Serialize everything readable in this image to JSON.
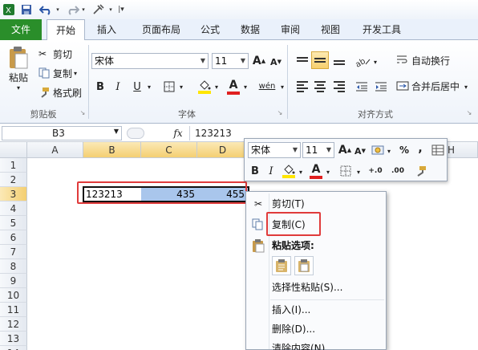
{
  "colors": {
    "file_tab": "#2a8e2a",
    "selected_header": "#f4cf72",
    "selection_fill": "#a9c6ec",
    "highlight_box": "#e03b3b",
    "font_color_bar": "#e02020",
    "fill_color_bar": "#ffe600"
  },
  "qat": {
    "icons": [
      "excel-logo-icon",
      "save-icon",
      "undo-icon",
      "redo-icon",
      "customize-icon"
    ]
  },
  "tabs": {
    "file": "文件",
    "items": [
      "开始",
      "插入",
      "页面布局",
      "公式",
      "数据",
      "审阅",
      "视图",
      "开发工具"
    ],
    "active": "开始"
  },
  "clipboard": {
    "group": "剪贴板",
    "paste": "粘贴",
    "cut": "剪切",
    "copy": "复制",
    "format_painter": "格式刷"
  },
  "font": {
    "group": "字体",
    "name": "宋体",
    "size": "11",
    "bold": "B",
    "italic": "I",
    "underline": "U",
    "grow": "A",
    "shrink": "A",
    "font_color": "A",
    "phonetic": "wén"
  },
  "alignment": {
    "group": "对齐方式",
    "wrap": "自动换行",
    "merge": "合并后居中"
  },
  "formula_bar": {
    "name_box": "B3",
    "fx": "fx",
    "value": "123213"
  },
  "columns": [
    "A",
    "B",
    "C",
    "D",
    "H"
  ],
  "rows": [
    "1",
    "2",
    "3",
    "4",
    "5",
    "6",
    "7",
    "8",
    "9",
    "10",
    "11",
    "12",
    "13",
    "14"
  ],
  "cells": {
    "B3": "123213",
    "C3": "435",
    "D3": "455"
  },
  "mini_toolbar": {
    "font": "宋体",
    "size": "11",
    "grow": "A",
    "shrink": "A",
    "percent": "%",
    "comma": ",",
    "bold": "B",
    "italic": "I",
    "font_color": "A",
    "inc_decimal": "+.0",
    "dec_decimal": ".00"
  },
  "context_menu": {
    "cut": "剪切(T)",
    "copy": "复制(C)",
    "paste_options": "粘贴选项:",
    "paste_special": "选择性粘贴(S)...",
    "insert": "插入(I)...",
    "delete": "删除(D)...",
    "clear": "清除内容(N)"
  }
}
